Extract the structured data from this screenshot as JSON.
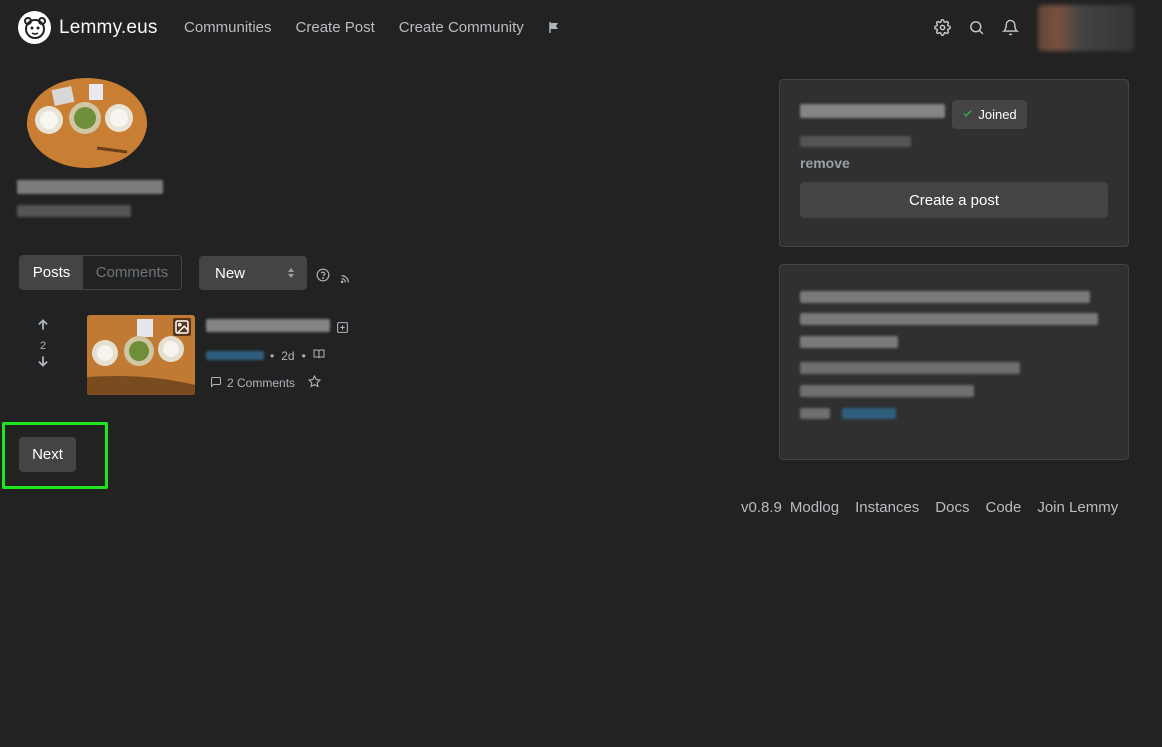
{
  "navbar": {
    "brand": "Lemmy.eus",
    "links": [
      "Communities",
      "Create Post",
      "Create Community"
    ],
    "icons": [
      "flag-icon",
      "gear-icon",
      "search-icon",
      "bell-icon"
    ]
  },
  "toolbar": {
    "tabs": [
      "Posts",
      "Comments"
    ],
    "active_tab": "Posts",
    "sort_value": "New"
  },
  "post": {
    "score": "2",
    "age": "2d",
    "comments_label": "2 Comments"
  },
  "pagination": {
    "next_label": "Next"
  },
  "sidebar": {
    "joined_label": "Joined",
    "remove_label": "remove",
    "create_post_label": "Create a post"
  },
  "footer": {
    "version": "v0.8.9",
    "links": [
      "Modlog",
      "Instances",
      "Docs",
      "Code",
      "Join Lemmy"
    ]
  },
  "colors": {
    "background": "#222222",
    "card": "#303030",
    "button": "#444444",
    "highlight": "#1fe51f",
    "joined_check": "#2fb344"
  }
}
